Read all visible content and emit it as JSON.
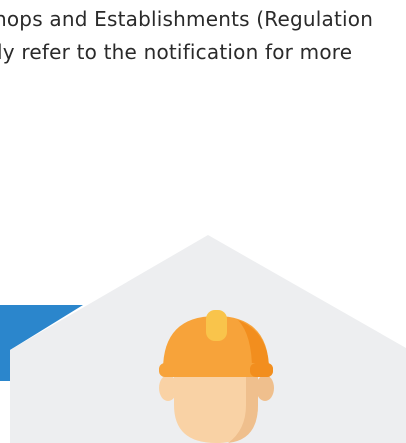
{
  "text": {
    "line1": "hops and Establishments (Regulation",
    "line2": "ly refer to the notification for more"
  },
  "illustration": {
    "banner_color": "#2b86cc",
    "house_color": "#edeef0",
    "helmet_color": "#f7a33a",
    "helmet_shadow_color": "#f28e1e",
    "helmet_ridge_color": "#f9c44b",
    "skin_color": "#f9d2a5",
    "skin_shadow_color": "#efbf8d"
  }
}
